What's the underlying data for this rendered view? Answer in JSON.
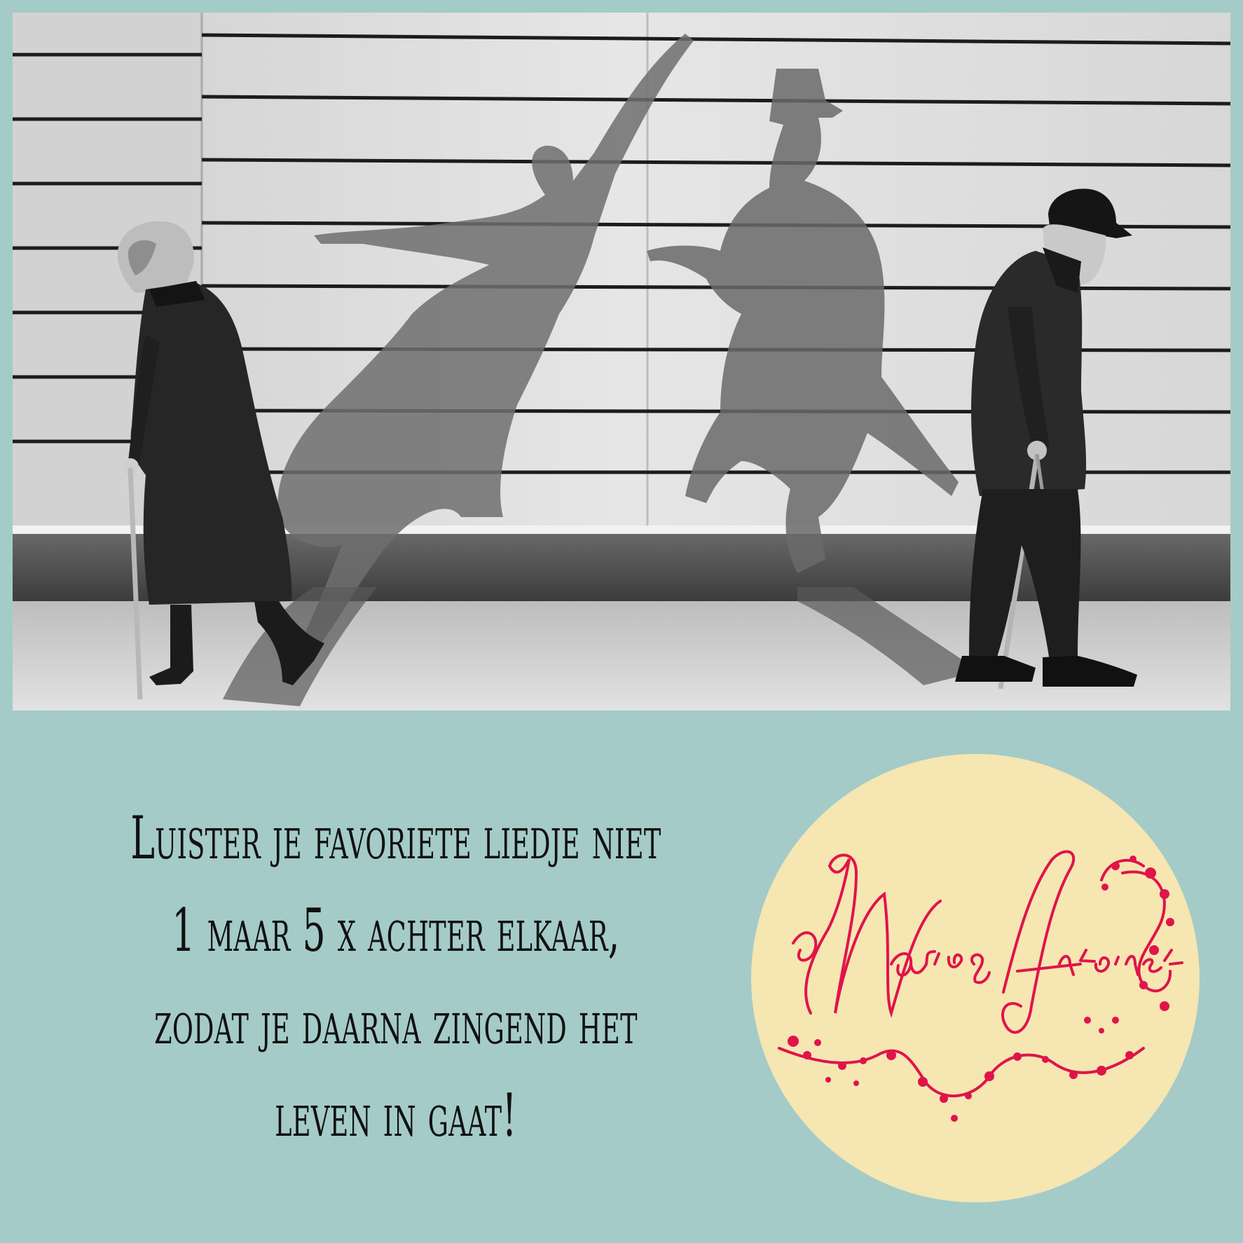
{
  "quote": {
    "lines": [
      "Luister je favoriete liedje niet",
      "1 maar 5 x achter elkaar,",
      "zodat je daarna zingend het",
      "leven in gaat!"
    ]
  },
  "logo": {
    "text": "Marie & Antoinette",
    "colors": {
      "circle": "#f5e6b2",
      "script": "#e0144a"
    }
  },
  "photo": {
    "kind": "black-and-white-photo",
    "subjects": [
      "elderly-woman-walking-icon",
      "elderly-man-walking-icon",
      "dancing-couple-shadow-icon"
    ]
  },
  "colors": {
    "background": "#a4cbc8",
    "text": "#111111"
  }
}
